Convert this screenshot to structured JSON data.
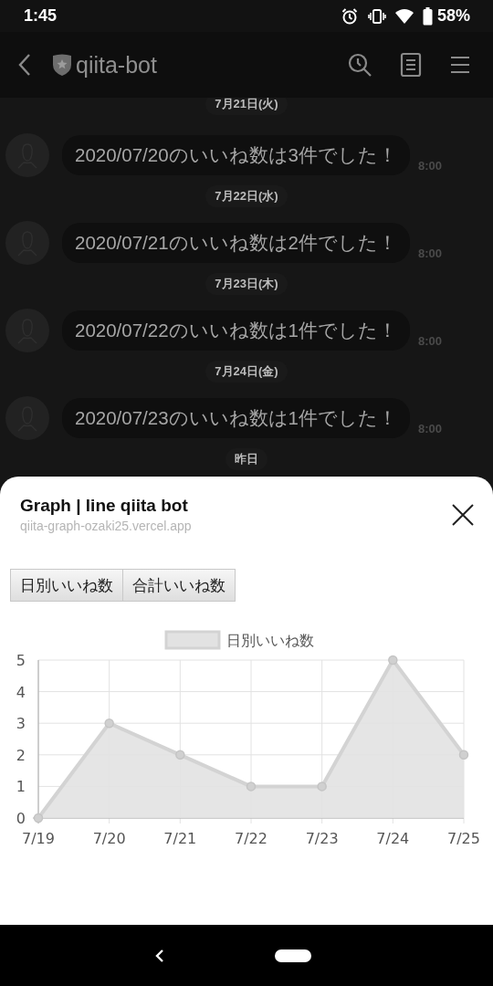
{
  "status_bar": {
    "time": "1:45",
    "battery": "58%"
  },
  "app_bar": {
    "title": "qiita-bot"
  },
  "timeline": [
    {
      "kind": "date",
      "text": "7月21日(火)"
    },
    {
      "kind": "message",
      "text": "2020/07/20のいいね数は3件でした！",
      "time": "8:00"
    },
    {
      "kind": "date",
      "text": "7月22日(水)"
    },
    {
      "kind": "message",
      "text": "2020/07/21のいいね数は2件でした！",
      "time": "8:00"
    },
    {
      "kind": "date",
      "text": "7月23日(木)"
    },
    {
      "kind": "message",
      "text": "2020/07/22のいいね数は1件でした！",
      "time": "8:00"
    },
    {
      "kind": "date",
      "text": "7月24日(金)"
    },
    {
      "kind": "message",
      "text": "2020/07/23のいいね数は1件でした！",
      "time": "8:00"
    },
    {
      "kind": "date",
      "text": "昨日"
    }
  ],
  "sheet": {
    "title": "Graph | line qiita bot",
    "url": "qiita-graph-ozaki25.vercel.app",
    "tabs": [
      {
        "label": "日別いいね数",
        "selected": false
      },
      {
        "label": "合計いいね数",
        "selected": false
      }
    ],
    "chart_data": {
      "type": "area",
      "categories": [
        "7/19",
        "7/20",
        "7/21",
        "7/22",
        "7/23",
        "7/24",
        "7/25"
      ],
      "series": [
        {
          "name": "日別いいね数",
          "color": "#e2e2e2",
          "values": [
            0,
            3,
            2,
            1,
            1,
            5,
            2
          ]
        }
      ],
      "ylim": [
        0,
        5
      ],
      "grid": true,
      "yticks": [
        0,
        1,
        2,
        3,
        4,
        5
      ]
    }
  }
}
